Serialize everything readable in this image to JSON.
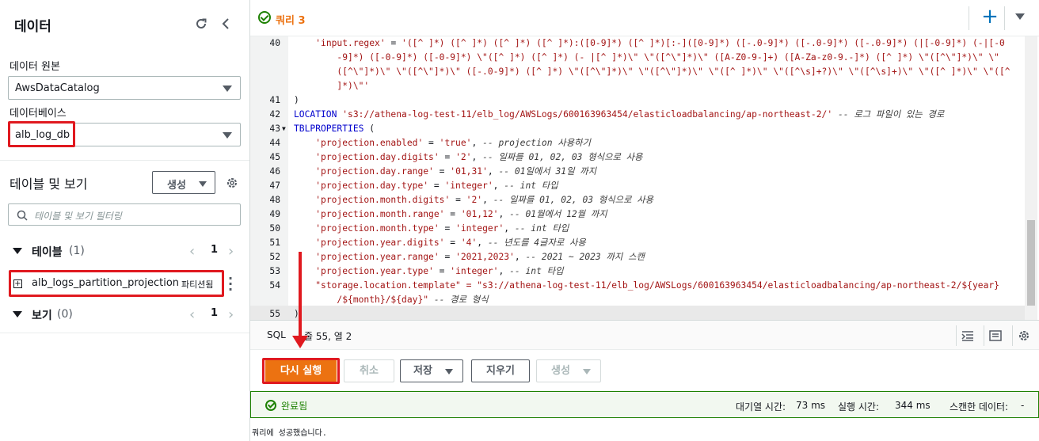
{
  "left_panel": {
    "title": "데이터",
    "data_source": {
      "label": "데이터 원본",
      "value": "AwsDataCatalog"
    },
    "database": {
      "label": "데이터베이스",
      "value": "alb_log_db"
    },
    "tables_views": {
      "title": "테이블 및 보기",
      "create_label": "생성",
      "filter_placeholder": "테이블 및 보기 필터링"
    },
    "tables_section": {
      "label": "테이블",
      "count": "(1)",
      "page": "1"
    },
    "table_item": {
      "name": "alb_logs_partition_projection",
      "badge": "파티션됨"
    },
    "views_section": {
      "label": "보기",
      "count": "(0)",
      "page": "1"
    }
  },
  "tab": {
    "title": "쿼리 3"
  },
  "editor": {
    "lines": [
      {
        "n": "40",
        "segs": [
          {
            "t": "    ",
            "c": ""
          },
          {
            "t": "'input.regex'",
            "c": "s"
          },
          {
            "t": " = ",
            "c": ""
          },
          {
            "t": "'([^ ]*) ([^ ]*) ([^ ]*) ([^ ]*):([0-9]*) ([^ ]*)[:-]([0-9]*) ([-.0-9]*) ([-.0-9]*) ([-.0-9]*) (|[-0-9]*) (-|[-0",
            "c": "s"
          }
        ]
      },
      {
        "n": "",
        "segs": [
          {
            "t": "        ",
            "c": ""
          },
          {
            "t": "-9]*) ([-0-9]*) ([-0-9]*) \\\"([^ ]*) ([^ ]*) (- |[^ ]*)\\\" \\\"([^\\\"]*)\\\" ([A-Z0-9-]+) ([A-Za-z0-9.-]*) ([^ ]*) \\\"([^\\\"]*)\\\" \\\"",
            "c": "s"
          }
        ]
      },
      {
        "n": "",
        "segs": [
          {
            "t": "        ",
            "c": ""
          },
          {
            "t": "([^\\\"]*)\\\" \\\"([^\\\"]*)\\\" ([-.0-9]*) ([^ ]*) \\\"([^\\\"]*)\\\" \\\"([^\\\"]*)\\\" \\\"([^ ]*)\\\" \\\"([^\\s]+?)\\\" \\\"([^\\s]+)\\\" \\\"([^ ]*)\\\" \\\"([^",
            "c": "s"
          }
        ]
      },
      {
        "n": "",
        "segs": [
          {
            "t": "        ",
            "c": ""
          },
          {
            "t": "]*)\\\"'",
            "c": "s"
          }
        ]
      },
      {
        "n": "41",
        "segs": [
          {
            "t": ")",
            "c": ""
          }
        ]
      },
      {
        "n": "42",
        "segs": [
          {
            "t": "LOCATION ",
            "c": "k"
          },
          {
            "t": "'s3://athena-log-test-11/elb_log/AWSLogs/600163963454/elasticloadbalancing/ap-northeast-2/'",
            "c": "s"
          },
          {
            "t": " -- 로그 파일이 있는 경로",
            "c": "c"
          }
        ]
      },
      {
        "n": "43",
        "fold": true,
        "segs": [
          {
            "t": "TBLPROPERTIES ",
            "c": "k"
          },
          {
            "t": "(",
            "c": ""
          }
        ]
      },
      {
        "n": "44",
        "segs": [
          {
            "t": "    ",
            "c": ""
          },
          {
            "t": "'projection.enabled'",
            "c": "s"
          },
          {
            "t": " = ",
            "c": ""
          },
          {
            "t": "'true'",
            "c": "s"
          },
          {
            "t": ", ",
            "c": ""
          },
          {
            "t": "-- projection 사용하기",
            "c": "c"
          }
        ]
      },
      {
        "n": "45",
        "segs": [
          {
            "t": "    ",
            "c": ""
          },
          {
            "t": "'projection.day.digits'",
            "c": "s"
          },
          {
            "t": " = ",
            "c": ""
          },
          {
            "t": "'2'",
            "c": "s"
          },
          {
            "t": ", ",
            "c": ""
          },
          {
            "t": "-- 일짜를 01, 02, 03 형식으로 사용",
            "c": "c"
          }
        ]
      },
      {
        "n": "46",
        "segs": [
          {
            "t": "    ",
            "c": ""
          },
          {
            "t": "'projection.day.range'",
            "c": "s"
          },
          {
            "t": " = ",
            "c": ""
          },
          {
            "t": "'01,31'",
            "c": "s"
          },
          {
            "t": ", ",
            "c": ""
          },
          {
            "t": "-- 01일에서 31일 까지",
            "c": "c"
          }
        ]
      },
      {
        "n": "47",
        "segs": [
          {
            "t": "    ",
            "c": ""
          },
          {
            "t": "'projection.day.type'",
            "c": "s"
          },
          {
            "t": " = ",
            "c": ""
          },
          {
            "t": "'integer'",
            "c": "s"
          },
          {
            "t": ", ",
            "c": ""
          },
          {
            "t": "-- int 타입",
            "c": "c"
          }
        ]
      },
      {
        "n": "48",
        "segs": [
          {
            "t": "    ",
            "c": ""
          },
          {
            "t": "'projection.month.digits'",
            "c": "s"
          },
          {
            "t": " = ",
            "c": ""
          },
          {
            "t": "'2'",
            "c": "s"
          },
          {
            "t": ", ",
            "c": ""
          },
          {
            "t": "-- 일짜를 01, 02, 03 형식으로 사용",
            "c": "c"
          }
        ]
      },
      {
        "n": "49",
        "segs": [
          {
            "t": "    ",
            "c": ""
          },
          {
            "t": "'projection.month.range'",
            "c": "s"
          },
          {
            "t": " = ",
            "c": ""
          },
          {
            "t": "'01,12'",
            "c": "s"
          },
          {
            "t": ", ",
            "c": ""
          },
          {
            "t": "-- 01월에서 12월 까지",
            "c": "c"
          }
        ]
      },
      {
        "n": "50",
        "segs": [
          {
            "t": "    ",
            "c": ""
          },
          {
            "t": "'projection.month.type'",
            "c": "s"
          },
          {
            "t": " = ",
            "c": ""
          },
          {
            "t": "'integer'",
            "c": "s"
          },
          {
            "t": ", ",
            "c": ""
          },
          {
            "t": "-- int 타입",
            "c": "c"
          }
        ]
      },
      {
        "n": "51",
        "segs": [
          {
            "t": "    ",
            "c": ""
          },
          {
            "t": "'projection.year.digits'",
            "c": "s"
          },
          {
            "t": " = ",
            "c": ""
          },
          {
            "t": "'4'",
            "c": "s"
          },
          {
            "t": ", ",
            "c": ""
          },
          {
            "t": "-- 년도를 4글자로 사용",
            "c": "c"
          }
        ]
      },
      {
        "n": "52",
        "segs": [
          {
            "t": "    ",
            "c": ""
          },
          {
            "t": "'projection.year.range'",
            "c": "s"
          },
          {
            "t": " = ",
            "c": ""
          },
          {
            "t": "'2021,2023'",
            "c": "s"
          },
          {
            "t": ", ",
            "c": ""
          },
          {
            "t": "-- 2021 ~ 2023 까지 스캔",
            "c": "c"
          }
        ]
      },
      {
        "n": "53",
        "segs": [
          {
            "t": "    ",
            "c": ""
          },
          {
            "t": "'projection.year.type'",
            "c": "s"
          },
          {
            "t": " = ",
            "c": ""
          },
          {
            "t": "'integer'",
            "c": "s"
          },
          {
            "t": ", ",
            "c": ""
          },
          {
            "t": "-- int 타입",
            "c": "c"
          }
        ]
      },
      {
        "n": "54",
        "segs": [
          {
            "t": "    ",
            "c": ""
          },
          {
            "t": "\"storage.location.template\" = \"s3://athena-log-test-11/elb_log/AWSLogs/600163963454/elasticloadbalancing/ap-northeast-2/${year}",
            "c": "s"
          }
        ]
      },
      {
        "n": "",
        "segs": [
          {
            "t": "        ",
            "c": ""
          },
          {
            "t": "/${month}/${day}\"",
            "c": "s"
          },
          {
            "t": " -- 경로 형식",
            "c": "c"
          }
        ]
      },
      {
        "n": "55",
        "segs": [
          {
            "t": ")",
            "c": ""
          }
        ]
      }
    ]
  },
  "status_bar": {
    "lang": "SQL",
    "position": "줄 55, 열 2"
  },
  "actions": {
    "run": "다시 실행",
    "cancel": "취소",
    "save": "저장",
    "clear": "지우기",
    "generate": "생성"
  },
  "result": {
    "status": "완료됨",
    "queue_time": "대기열 시간:",
    "queue_value": "73 ms",
    "run_time": "실행 시간:",
    "run_value": "344 ms",
    "scanned": "스캔한 데이터:",
    "scanned_value": "-",
    "message": "쿼리에 성공했습니다."
  },
  "colors": {
    "accent": "#ec7211",
    "success": "#1d8102",
    "highlight": "#e0191f",
    "link": "#0073bb"
  }
}
